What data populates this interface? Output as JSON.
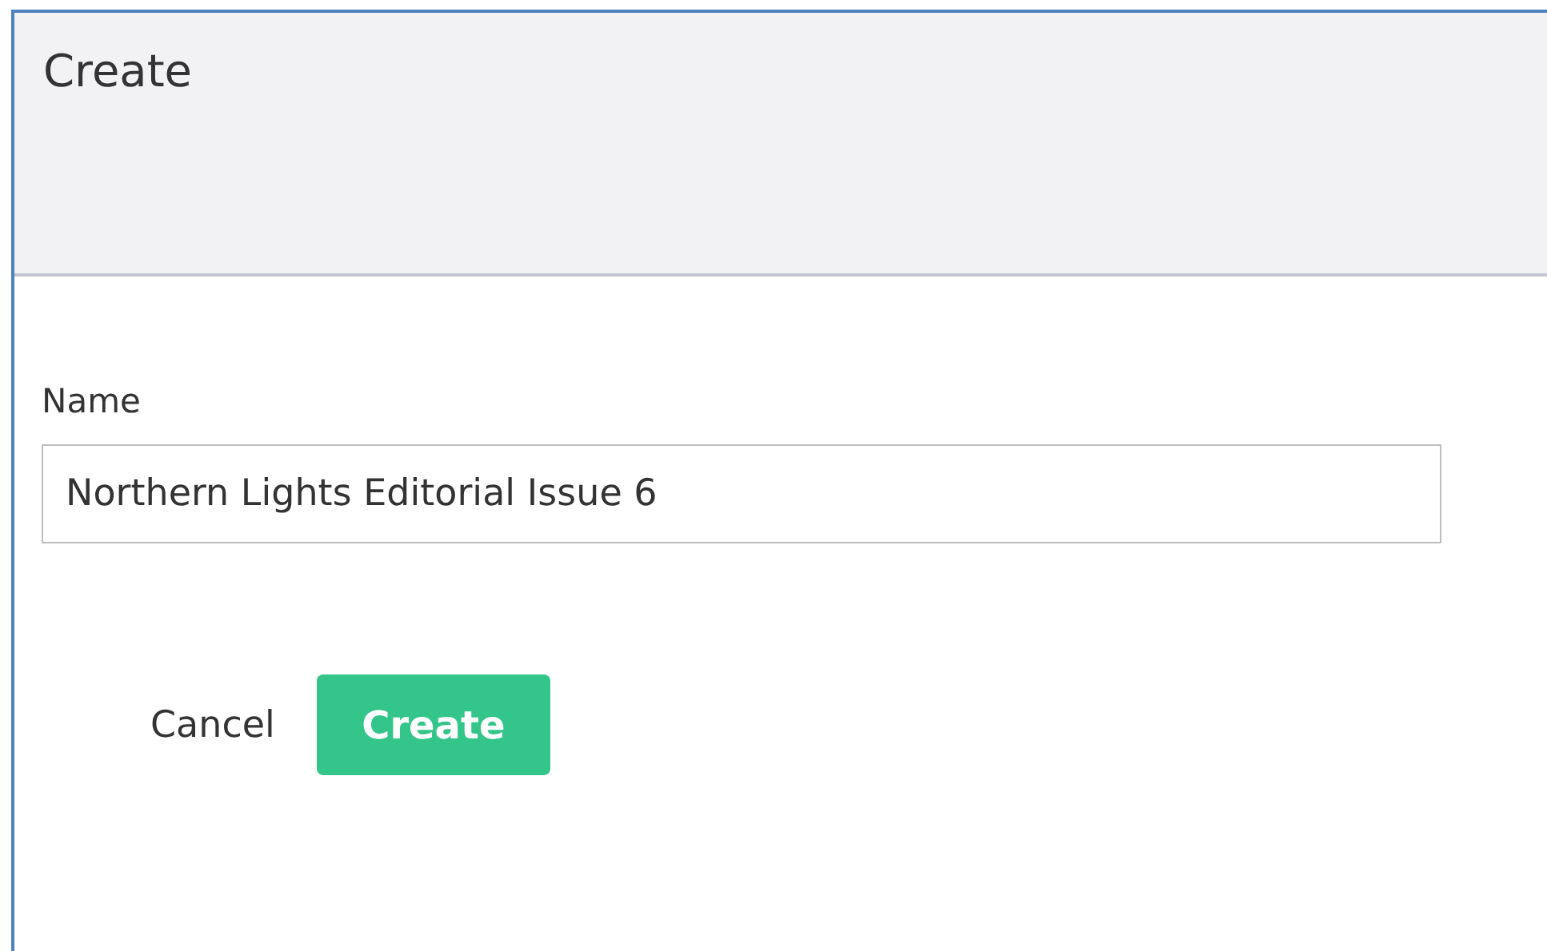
{
  "dialog": {
    "title": "Create"
  },
  "name_field": {
    "label": "Name",
    "value": "Northern Lights Editorial Issue 6"
  },
  "buttons": [
    {
      "kind": "link",
      "label": "Cancel"
    },
    {
      "kind": "primary",
      "label": "Create"
    }
  ]
}
